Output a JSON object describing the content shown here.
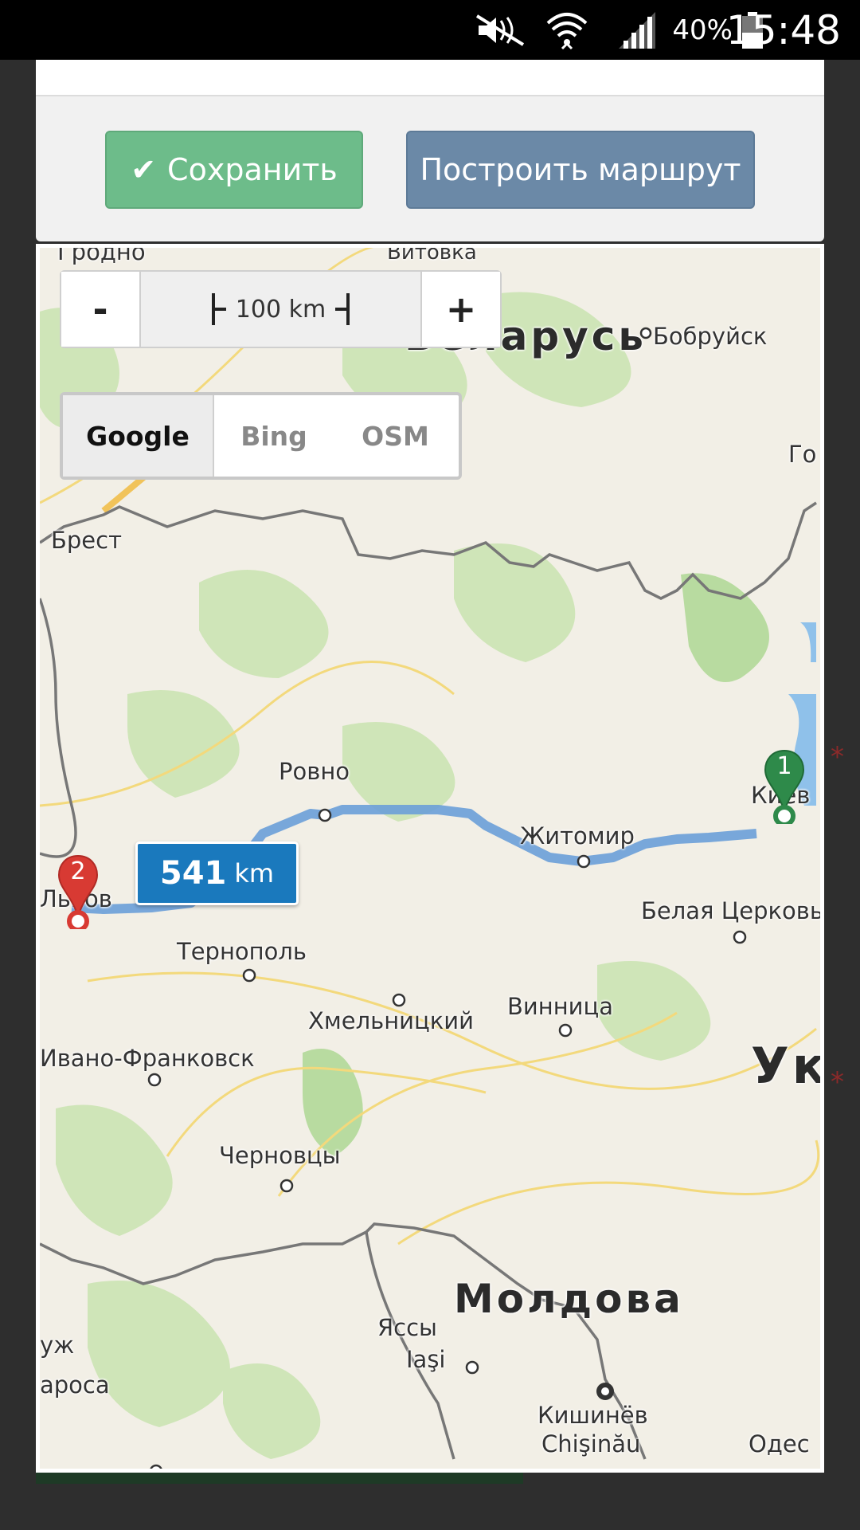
{
  "status_bar": {
    "time": "15:48",
    "battery": "40%",
    "icons": [
      "mute-icon",
      "wifi-icon",
      "signal-icon",
      "battery-icon"
    ]
  },
  "toolbar": {
    "save_label": "Сохранить",
    "route_label": "Построить маршрут"
  },
  "map": {
    "zoom": {
      "minus": "-",
      "plus": "+",
      "scale": "100 km"
    },
    "layers": {
      "google": "Google",
      "bing": "Bing",
      "osm": "OSM",
      "selected": "Google"
    },
    "route": {
      "distance_value": "541",
      "distance_unit": "km"
    },
    "markers": {
      "start": "1",
      "end": "2"
    },
    "labels": {
      "grodno": "Гродно",
      "vitovka": "Витовка",
      "belarus": "Беларусь",
      "bobruisk": "Бобруйск",
      "go": "Го",
      "brest": "Брест",
      "rovno": "Ровно",
      "zhitomir": "Житомир",
      "kiev": "Киев",
      "lvov": "Львов",
      "belaya_tserkov": "Белая Церковь",
      "ternopol": "Тернополь",
      "khmelnitsky": "Хмельницкий",
      "vinnitsa": "Винница",
      "ivano_frankovsk": "Ивано-Франковск",
      "ukraine": "Ук",
      "chernovtsy": "Черновцы",
      "moldova": "Молдова",
      "iasi_ru": "Яссы",
      "iasi_ro": "Iaşi",
      "chisinau_ru": "Кишинёв",
      "chisinau_ro": "Chişinău",
      "odessa": "Одес",
      "uzh": "уж",
      "aroca": "ароса"
    }
  },
  "colors": {
    "save": "#6dbc8a",
    "route_button": "#6b89a7",
    "distance_badge": "#1a79bd",
    "route_line": "#6a9fd8",
    "marker_start": "#2e8a4a",
    "marker_end": "#d83a33"
  }
}
